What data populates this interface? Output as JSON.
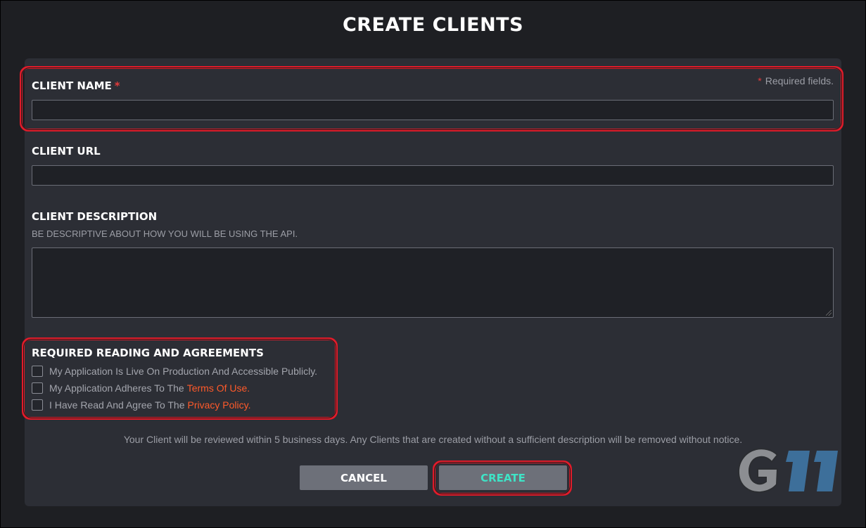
{
  "page": {
    "title": "CREATE CLIENTS"
  },
  "form": {
    "required_note": "Required fields.",
    "required_star": "*",
    "client_name": {
      "label": "CLIENT NAME",
      "value": ""
    },
    "client_url": {
      "label": "CLIENT URL",
      "value": ""
    },
    "client_description": {
      "label": "CLIENT DESCRIPTION",
      "hint": "BE DESCRIPTIVE ABOUT HOW YOU WILL BE USING THE API.",
      "value": ""
    }
  },
  "agreements": {
    "title": "REQUIRED READING AND AGREEMENTS",
    "items": [
      {
        "text": "My Application Is Live On Production And Accessible Publicly.",
        "link": "",
        "checked": false
      },
      {
        "text": "My Application Adheres To The",
        "link": "Terms Of Use.",
        "checked": false
      },
      {
        "text": "I Have Read And Agree To The",
        "link": "Privacy Policy.",
        "checked": false
      }
    ]
  },
  "review_note": "Your Client will be reviewed within 5 business days. Any Clients that are created without a sufficient description will be removed without notice.",
  "buttons": {
    "cancel": "CANCEL",
    "create": "CREATE"
  },
  "watermark": {
    "text": "G11",
    "icon": "g11-logo-icon"
  },
  "colors": {
    "background": "#1e1f23",
    "panel": "#2c2e35",
    "highlight": "#e21b2a",
    "link": "#ff5a2a",
    "create_text": "#3fe3c6",
    "required": "#e23b3b"
  }
}
